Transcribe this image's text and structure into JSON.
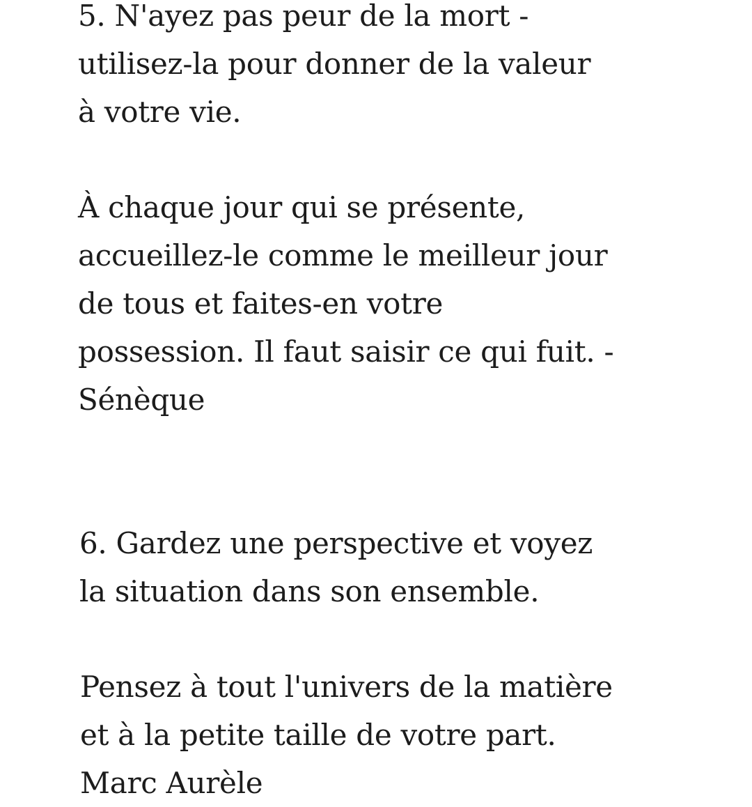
{
  "sections": [
    {
      "title_lines": [
        "5. N'ayez pas peur de la mort -",
        "utilisez-la pour donner de la valeur",
        "à votre vie."
      ],
      "quote_lines": [
        "À chaque jour qui se présente,",
        "accueillez-le comme le meilleur jour",
        "de tous et faites-en votre",
        "possession. Il faut saisir ce qui fuit. -",
        "Sénèque"
      ]
    },
    {
      "title_lines": [
        "6. Gardez une perspective et voyez",
        "la situation dans son ensemble."
      ],
      "quote_lines": [
        "Pensez à tout l'univers de la matière",
        "et à la petite taille de votre part.",
        "Marc Aurèle"
      ]
    }
  ]
}
